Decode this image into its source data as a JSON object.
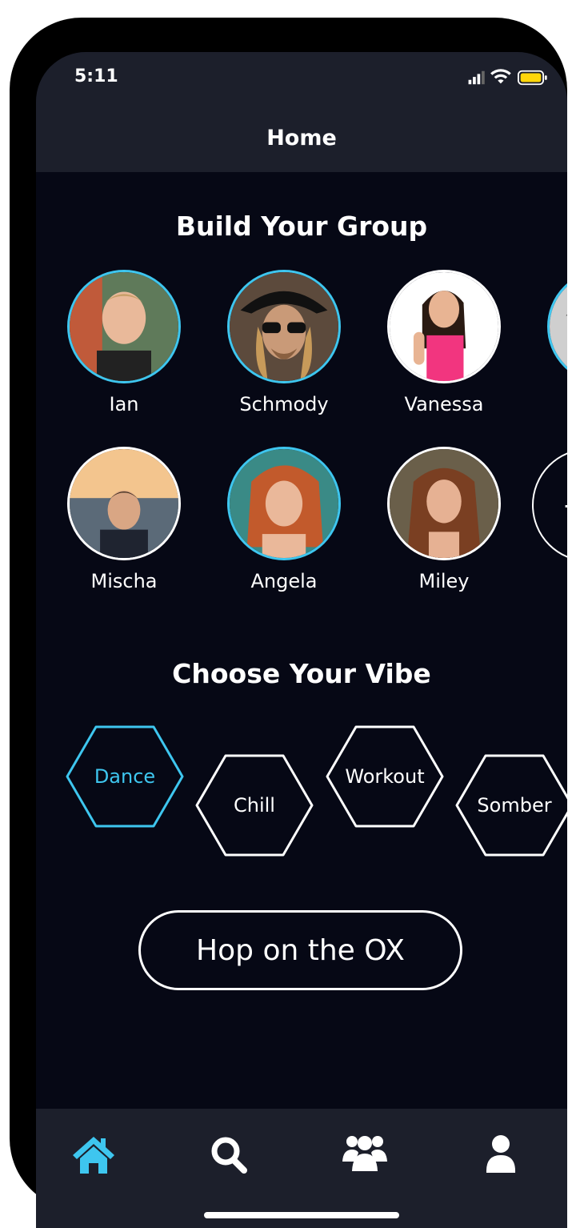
{
  "status_bar": {
    "time": "5:11"
  },
  "header": {
    "title": "Home"
  },
  "group_section": {
    "title": "Build Your Group",
    "friends": [
      {
        "name": "Ian",
        "selected": true
      },
      {
        "name": "Schmody",
        "selected": true
      },
      {
        "name": "Vanessa",
        "selected": false
      },
      {
        "name": "",
        "selected": true
      },
      {
        "name": "Mischa",
        "selected": false
      },
      {
        "name": "Angela",
        "selected": true
      },
      {
        "name": "Miley",
        "selected": false
      }
    ],
    "add_button": {
      "icon": "plus-icon",
      "label": "+"
    }
  },
  "vibe_section": {
    "title": "Choose Your Vibe",
    "vibes": [
      {
        "label": "Dance",
        "selected": true
      },
      {
        "label": "Chill",
        "selected": false
      },
      {
        "label": "Workout",
        "selected": false
      },
      {
        "label": "Somber",
        "selected": false
      }
    ]
  },
  "primary_action": {
    "label": "Hop on the OX"
  },
  "tab_bar": {
    "tabs": [
      {
        "icon": "home-icon",
        "active": true
      },
      {
        "icon": "search-icon",
        "active": false
      },
      {
        "icon": "group-icon",
        "active": false
      },
      {
        "icon": "profile-icon",
        "active": false
      }
    ]
  },
  "colors": {
    "accent": "#3ec6ef",
    "background": "#060815",
    "bar": "#1c1f2b",
    "text": "#ffffff"
  }
}
